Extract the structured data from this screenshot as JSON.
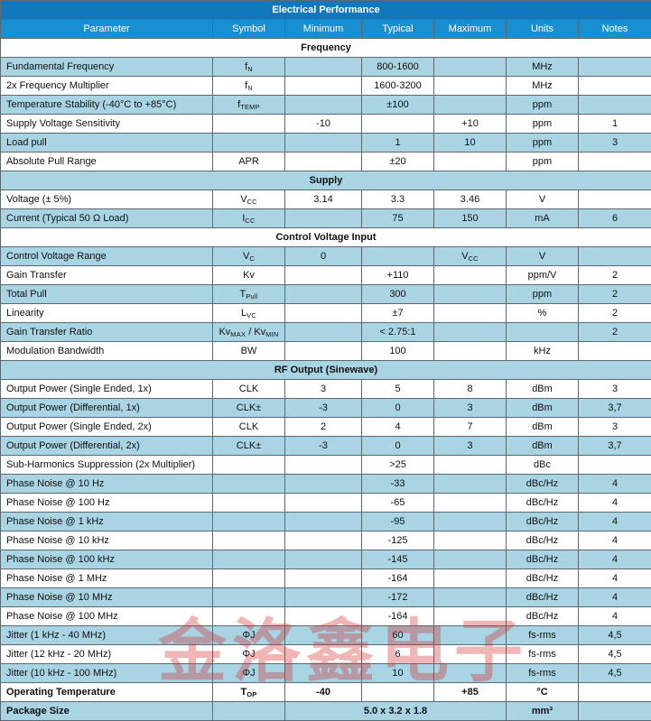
{
  "table": {
    "title": "Electrical Performance",
    "columns": [
      "Parameter",
      "Symbol",
      "Minimum",
      "Typical",
      "Maximum",
      "Units",
      "Notes"
    ],
    "colors": {
      "title_bg": "#1278be",
      "column_header_bg": "#1a8fd0",
      "row_alt_bg": "#a8d4e4",
      "row_bg": "#ffffff",
      "border": "#5a6a70",
      "text": "#111111",
      "watermark": "#d42b2b"
    },
    "sections": [
      {
        "name": "Frequency",
        "shade": "white",
        "rows": [
          {
            "parameter": "Fundamental Frequency",
            "symbol": "f_N",
            "symbol_base": "f",
            "symbol_sub": "N",
            "minimum": "",
            "typical": "800-1600",
            "maximum": "",
            "units": "MHz",
            "notes": "",
            "shade": "blue"
          },
          {
            "parameter": "2x Frequency Multiplier",
            "symbol": "f_N",
            "symbol_base": "f",
            "symbol_sub": "N",
            "minimum": "",
            "typical": "1600-3200",
            "maximum": "",
            "units": "MHz",
            "notes": "",
            "shade": "white"
          },
          {
            "parameter": "Temperature Stability (-40°C to +85°C)",
            "symbol": "f_TEMP",
            "symbol_base": "f",
            "symbol_sub": "TEMP",
            "minimum": "",
            "typical": "±100",
            "maximum": "",
            "units": "ppm",
            "notes": "",
            "shade": "blue"
          },
          {
            "parameter": "Supply Voltage Sensitivity",
            "symbol": "",
            "symbol_base": "",
            "symbol_sub": "",
            "minimum": "-10",
            "typical": "",
            "maximum": "+10",
            "units": "ppm",
            "notes": "1",
            "shade": "white"
          },
          {
            "parameter": "Load pull",
            "symbol": "",
            "symbol_base": "",
            "symbol_sub": "",
            "minimum": "",
            "typical": "1",
            "maximum": "10",
            "units": "ppm",
            "notes": "3",
            "shade": "blue"
          },
          {
            "parameter": "Absolute Pull Range",
            "symbol": "APR",
            "symbol_base": "APR",
            "symbol_sub": "",
            "minimum": "",
            "typical": "±20",
            "maximum": "",
            "units": "ppm",
            "notes": "",
            "shade": "white"
          }
        ]
      },
      {
        "name": "Supply",
        "shade": "blue",
        "rows": [
          {
            "parameter": "Voltage (± 5%)",
            "symbol": "V_CC",
            "symbol_base": "V",
            "symbol_sub": "CC",
            "minimum": "3.14",
            "typical": "3.3",
            "maximum": "3.46",
            "units": "V",
            "notes": "",
            "shade": "white"
          },
          {
            "parameter": "Current (Typical 50 Ω Load)",
            "symbol": "I_CC",
            "symbol_base": "I",
            "symbol_sub": "CC",
            "minimum": "",
            "typical": "75",
            "maximum": "150",
            "units": "mA",
            "notes": "6",
            "shade": "blue"
          }
        ]
      },
      {
        "name": "Control Voltage Input",
        "shade": "white",
        "rows": [
          {
            "parameter": "Control Voltage Range",
            "symbol": "V_C",
            "symbol_base": "V",
            "symbol_sub": "C",
            "minimum": "0",
            "typical": "",
            "maximum": "V_CC",
            "maximum_base": "V",
            "maximum_sub": "CC",
            "units": "V",
            "notes": "",
            "shade": "blue"
          },
          {
            "parameter": "Gain Transfer",
            "symbol": "Kv",
            "symbol_base": "Kv",
            "symbol_sub": "",
            "minimum": "",
            "typical": "+110",
            "maximum": "",
            "units": "ppm/V",
            "notes": "2",
            "shade": "white"
          },
          {
            "parameter": "Total Pull",
            "symbol": "T_Pull",
            "symbol_base": "T",
            "symbol_sub": "Pull",
            "minimum": "",
            "typical": "300",
            "maximum": "",
            "units": "ppm",
            "notes": "2",
            "shade": "blue"
          },
          {
            "parameter": "Linearity",
            "symbol": "L_VC",
            "symbol_base": "L",
            "symbol_sub": "VC",
            "minimum": "",
            "typical": "±7",
            "maximum": "",
            "units": "%",
            "notes": "2",
            "shade": "white"
          },
          {
            "parameter": "Gain Transfer Ratio",
            "symbol": "Kv_MAX / Kv_MIN",
            "symbol_base": "Kv",
            "symbol_sub": "MAX",
            "symbol_base2": "/ Kv",
            "symbol_sub2": "MIN",
            "minimum": "",
            "typical": "< 2.75:1",
            "maximum": "",
            "units": "",
            "notes": "2",
            "shade": "blue"
          },
          {
            "parameter": "Modulation Bandwidth",
            "symbol": "BW",
            "symbol_base": "BW",
            "symbol_sub": "",
            "minimum": "",
            "typical": "100",
            "maximum": "",
            "units": "kHz",
            "notes": "",
            "shade": "white"
          }
        ]
      },
      {
        "name": "RF Output (Sinewave)",
        "shade": "blue",
        "rows": [
          {
            "parameter": "Output Power (Single Ended, 1x)",
            "symbol": "CLK",
            "symbol_base": "CLK",
            "symbol_sub": "",
            "minimum": "3",
            "typical": "5",
            "maximum": "8",
            "units": "dBm",
            "notes": "3",
            "shade": "white"
          },
          {
            "parameter": "Output Power (Differential, 1x)",
            "symbol": "CLK±",
            "symbol_base": "CLK±",
            "symbol_sub": "",
            "minimum": "-3",
            "typical": "0",
            "maximum": "3",
            "units": "dBm",
            "notes": "3,7",
            "shade": "blue"
          },
          {
            "parameter": "Output Power (Single Ended, 2x)",
            "symbol": "CLK",
            "symbol_base": "CLK",
            "symbol_sub": "",
            "minimum": "2",
            "typical": "4",
            "maximum": "7",
            "units": "dBm",
            "notes": "3",
            "shade": "white"
          },
          {
            "parameter": "Output Power (Differential, 2x)",
            "symbol": "CLK±",
            "symbol_base": "CLK±",
            "symbol_sub": "",
            "minimum": "-3",
            "typical": "0",
            "maximum": "3",
            "units": "dBm",
            "notes": "3,7",
            "shade": "blue"
          },
          {
            "parameter": "Sub-Harmonics Suppression (2x Multiplier)",
            "symbol": "",
            "symbol_base": "",
            "symbol_sub": "",
            "minimum": "",
            "typical": ">25",
            "maximum": "",
            "units": "dBc",
            "notes": "",
            "shade": "white"
          },
          {
            "parameter": "Phase Noise @ 10 Hz",
            "symbol": "",
            "symbol_base": "",
            "symbol_sub": "",
            "minimum": "",
            "typical": "-33",
            "maximum": "",
            "units": "dBc/Hz",
            "notes": "4",
            "shade": "blue"
          },
          {
            "parameter": "Phase Noise @ 100 Hz",
            "symbol": "",
            "symbol_base": "",
            "symbol_sub": "",
            "minimum": "",
            "typical": "-65",
            "maximum": "",
            "units": "dBc/Hz",
            "notes": "4",
            "shade": "white"
          },
          {
            "parameter": "Phase Noise @ 1 kHz",
            "symbol": "",
            "symbol_base": "",
            "symbol_sub": "",
            "minimum": "",
            "typical": "-95",
            "maximum": "",
            "units": "dBc/Hz",
            "notes": "4",
            "shade": "blue"
          },
          {
            "parameter": "Phase Noise @ 10 kHz",
            "symbol": "",
            "symbol_base": "",
            "symbol_sub": "",
            "minimum": "",
            "typical": "-125",
            "maximum": "",
            "units": "dBc/Hz",
            "notes": "4",
            "shade": "white"
          },
          {
            "parameter": "Phase Noise @ 100 kHz",
            "symbol": "",
            "symbol_base": "",
            "symbol_sub": "",
            "minimum": "",
            "typical": "-145",
            "maximum": "",
            "units": "dBc/Hz",
            "notes": "4",
            "shade": "blue"
          },
          {
            "parameter": "Phase Noise @ 1 MHz",
            "symbol": "",
            "symbol_base": "",
            "symbol_sub": "",
            "minimum": "",
            "typical": "-164",
            "maximum": "",
            "units": "dBc/Hz",
            "notes": "4",
            "shade": "white"
          },
          {
            "parameter": "Phase Noise @ 10 MHz",
            "symbol": "",
            "symbol_base": "",
            "symbol_sub": "",
            "minimum": "",
            "typical": "-172",
            "maximum": "",
            "units": "dBc/Hz",
            "notes": "4",
            "shade": "blue"
          },
          {
            "parameter": "Phase Noise @ 100 MHz",
            "symbol": "",
            "symbol_base": "",
            "symbol_sub": "",
            "minimum": "",
            "typical": "-164",
            "maximum": "",
            "units": "dBc/Hz",
            "notes": "4",
            "shade": "white"
          },
          {
            "parameter": "Jitter (1 kHz - 40 MHz)",
            "symbol": "ΦJ",
            "symbol_base": "ΦJ",
            "symbol_sub": "",
            "minimum": "",
            "typical": "60",
            "maximum": "",
            "units": "fs-rms",
            "notes": "4,5",
            "shade": "blue"
          },
          {
            "parameter": "Jitter (12 kHz - 20 MHz)",
            "symbol": "ΦJ",
            "symbol_base": "ΦJ",
            "symbol_sub": "",
            "minimum": "",
            "typical": "6",
            "maximum": "",
            "units": "fs-rms",
            "notes": "4,5",
            "shade": "white"
          },
          {
            "parameter": "Jitter (10 kHz - 100 MHz)",
            "symbol": "ΦJ",
            "symbol_base": "ΦJ",
            "symbol_sub": "",
            "minimum": "",
            "typical": "10",
            "maximum": "",
            "units": "fs-rms",
            "notes": "4,5",
            "shade": "blue"
          },
          {
            "parameter": "Operating Temperature",
            "symbol": "T_OP",
            "symbol_base": "T",
            "symbol_sub": "OP",
            "minimum": "-40",
            "typical": "",
            "maximum": "+85",
            "units": "°C",
            "notes": "",
            "shade": "white",
            "bold": true
          },
          {
            "parameter": "Package Size",
            "symbol": "",
            "symbol_base": "",
            "symbol_sub": "",
            "span_value": "5.0 x 3.2 x 1.8",
            "units": "mm³",
            "notes": "",
            "shade": "blue",
            "bold": true,
            "span": true
          }
        ]
      }
    ]
  },
  "watermark": {
    "text": "金洛鑫电子"
  }
}
